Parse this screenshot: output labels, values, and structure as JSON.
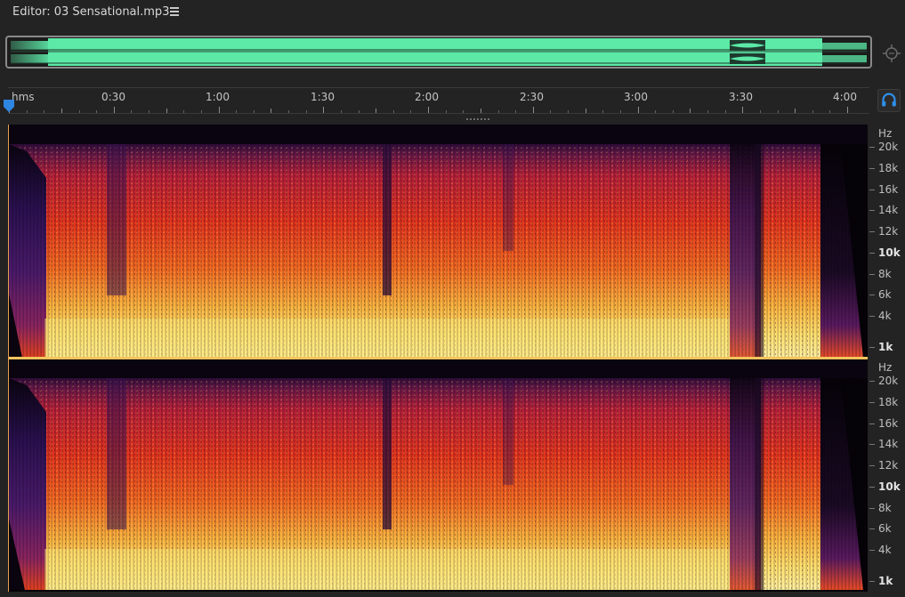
{
  "editor": {
    "title": "Editor: 03 Sensational.mp3",
    "menu_icon": "hamburger-menu-icon"
  },
  "overview": {
    "zoom_icon": "zoom-navigator-icon"
  },
  "ruler": {
    "unit_label": "hms",
    "time_labels": [
      "0:30",
      "1:00",
      "1:30",
      "2:00",
      "2:30",
      "3:00",
      "3:30",
      "4:00"
    ]
  },
  "headphone_icon": "headphones-icon",
  "frequency_scale": {
    "unit": "Hz",
    "labels": [
      "20k",
      "18k",
      "16k",
      "14k",
      "12k",
      "10k",
      "8k",
      "6k",
      "4k",
      "1k"
    ],
    "bold_labels": [
      "10k",
      "1k"
    ]
  },
  "colors": {
    "waveform": "#5ce9a7",
    "spectrogram_low": "#ffe56a",
    "spectrogram_mid": "#e8321e",
    "spectrogram_high": "#4a1a6a",
    "background": "#232323"
  }
}
